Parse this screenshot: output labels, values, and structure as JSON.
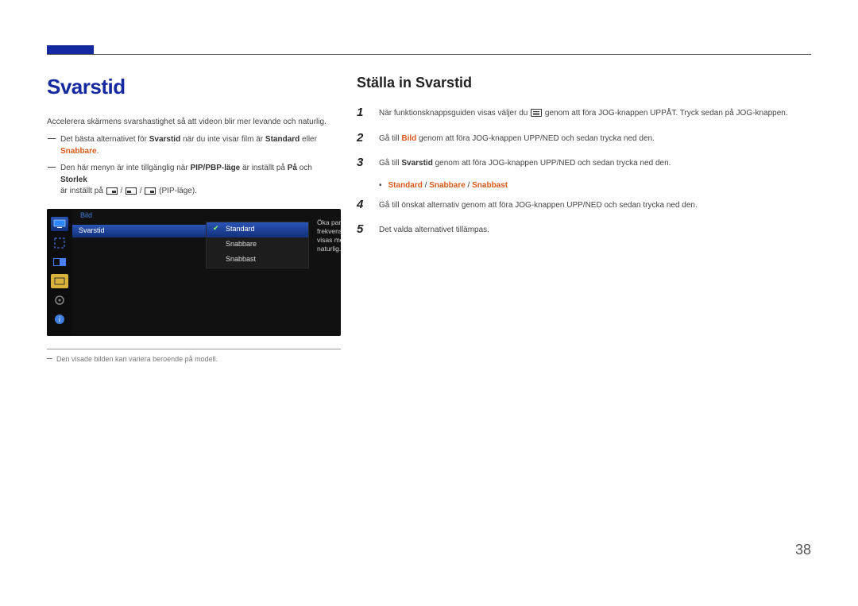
{
  "page_number": "38",
  "left": {
    "title": "Svarstid",
    "intro": "Accelerera skärmens svarshastighet så att videon blir mer levande och naturlig.",
    "note1_prefix": "Det bästa alternativet för ",
    "note1_b1": "Svarstid",
    "note1_mid": " när du inte visar film är ",
    "note1_b2": "Standard",
    "note1_mid2": " eller ",
    "note1_b3": "Snabbare",
    "note1_end": ".",
    "note2_prefix": "Den här menyn är inte tillgänglig när ",
    "note2_b1": "PIP/PBP-läge",
    "note2_mid": " är inställt på ",
    "note2_b2": "På",
    "note2_mid2": " och ",
    "note2_b3": "Storlek",
    "note2_line2_prefix": "är inställt på ",
    "note2_line2_suffix": " (PIP-läge).",
    "footnote": "Den visade bilden kan variera beroende på modell."
  },
  "osd": {
    "breadcrumb": "Bild",
    "row": "Svarstid",
    "options": [
      "Standard",
      "Snabbare",
      "Snabbast"
    ],
    "desc": "Öka panelens frekvens så att videon visas mer livfull och naturlig."
  },
  "right": {
    "title": "Ställa in Svarstid",
    "steps": [
      {
        "num": "1",
        "pre": "När funktionsknappsguiden visas väljer du ",
        "post": " genom att föra JOG-knappen UPPÅT. Tryck sedan på JOG-knappen.",
        "icon": true
      },
      {
        "num": "2",
        "pre": "Gå till ",
        "bold": "Bild",
        "post": " genom att föra JOG-knappen UPP/NED och sedan trycka ned den."
      },
      {
        "num": "3",
        "pre": "Gå till ",
        "bold": "Svarstid",
        "post": " genom att föra JOG-knappen UPP/NED och sedan trycka ned den."
      },
      {
        "num": "4",
        "text": "Gå till önskat alternativ genom att föra JOG-knappen UPP/NED och sedan trycka ned den."
      },
      {
        "num": "5",
        "text": "Det valda alternativet tillämpas."
      }
    ],
    "option_bullet": {
      "a": "Standard",
      "b": "Snabbare",
      "c": "Snabbast",
      "sep": " / "
    }
  }
}
